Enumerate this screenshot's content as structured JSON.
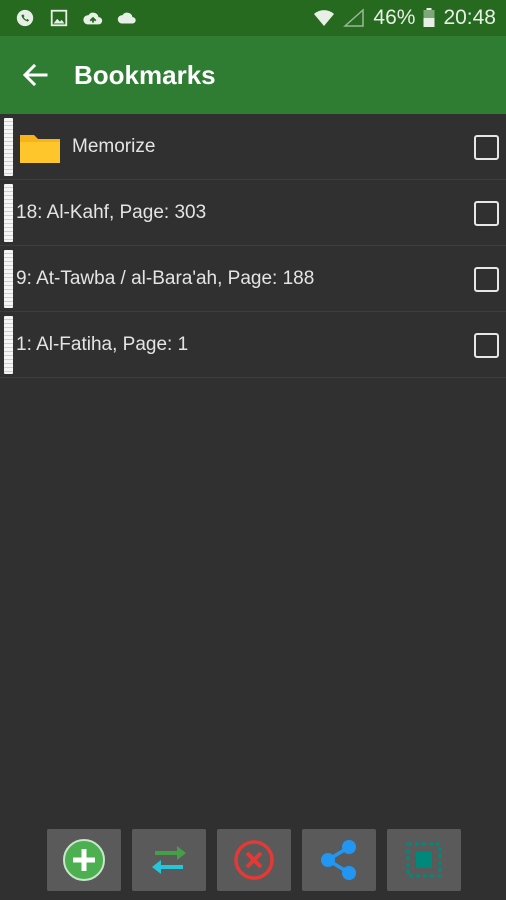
{
  "status_bar": {
    "battery": "46%",
    "time": "20:48",
    "icons": [
      "whatsapp-icon",
      "image-icon",
      "cloud-upload-icon",
      "cloud-icon",
      "wifi-icon",
      "signal-icon",
      "battery-icon"
    ]
  },
  "app_bar": {
    "title": "Bookmarks",
    "back_icon": "arrow-back-icon"
  },
  "folder": {
    "label": "Memorize",
    "icon": "folder-icon",
    "color": "#f9b31a"
  },
  "bookmarks": [
    {
      "label": "18:  Al-Kahf, Page: 303"
    },
    {
      "label": "9:  At-Tawba / al-Bara'ah, Page: 188"
    },
    {
      "label": "1:  Al-Fatiha, Page: 1"
    }
  ],
  "toolbar": {
    "buttons": [
      {
        "name": "add-button",
        "icon": "plus-circle-icon",
        "color": "#4caf50"
      },
      {
        "name": "sort-button",
        "icon": "swap-arrows-icon",
        "color": "#26a69a"
      },
      {
        "name": "delete-button",
        "icon": "x-circle-icon",
        "color": "#e53935"
      },
      {
        "name": "share-button",
        "icon": "share-icon",
        "color": "#2196f3"
      },
      {
        "name": "select-all-button",
        "icon": "select-all-icon",
        "color": "#00897b"
      }
    ]
  },
  "colors": {
    "status_bar": "#256a1f",
    "app_bar": "#2e7d32",
    "background": "#303030"
  }
}
